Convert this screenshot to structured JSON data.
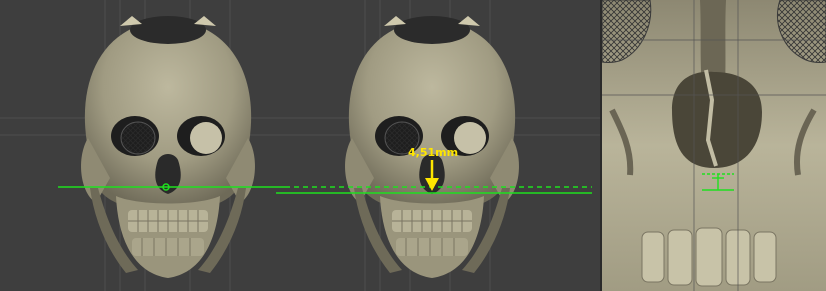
{
  "viewports": {
    "main": {
      "views": [
        "skull-front-baseline",
        "skull-front-measured"
      ]
    },
    "detail": {
      "view": "nasal-cavity-closeup"
    }
  },
  "measurement": {
    "label": "4,51mm",
    "color": "#ffe600"
  },
  "colors": {
    "background": "#3e3e3e",
    "grid": "#4a4a4a",
    "reference_line": "#1fe01f",
    "measure_arrow": "#ffe600",
    "bone": "#a49f86"
  }
}
